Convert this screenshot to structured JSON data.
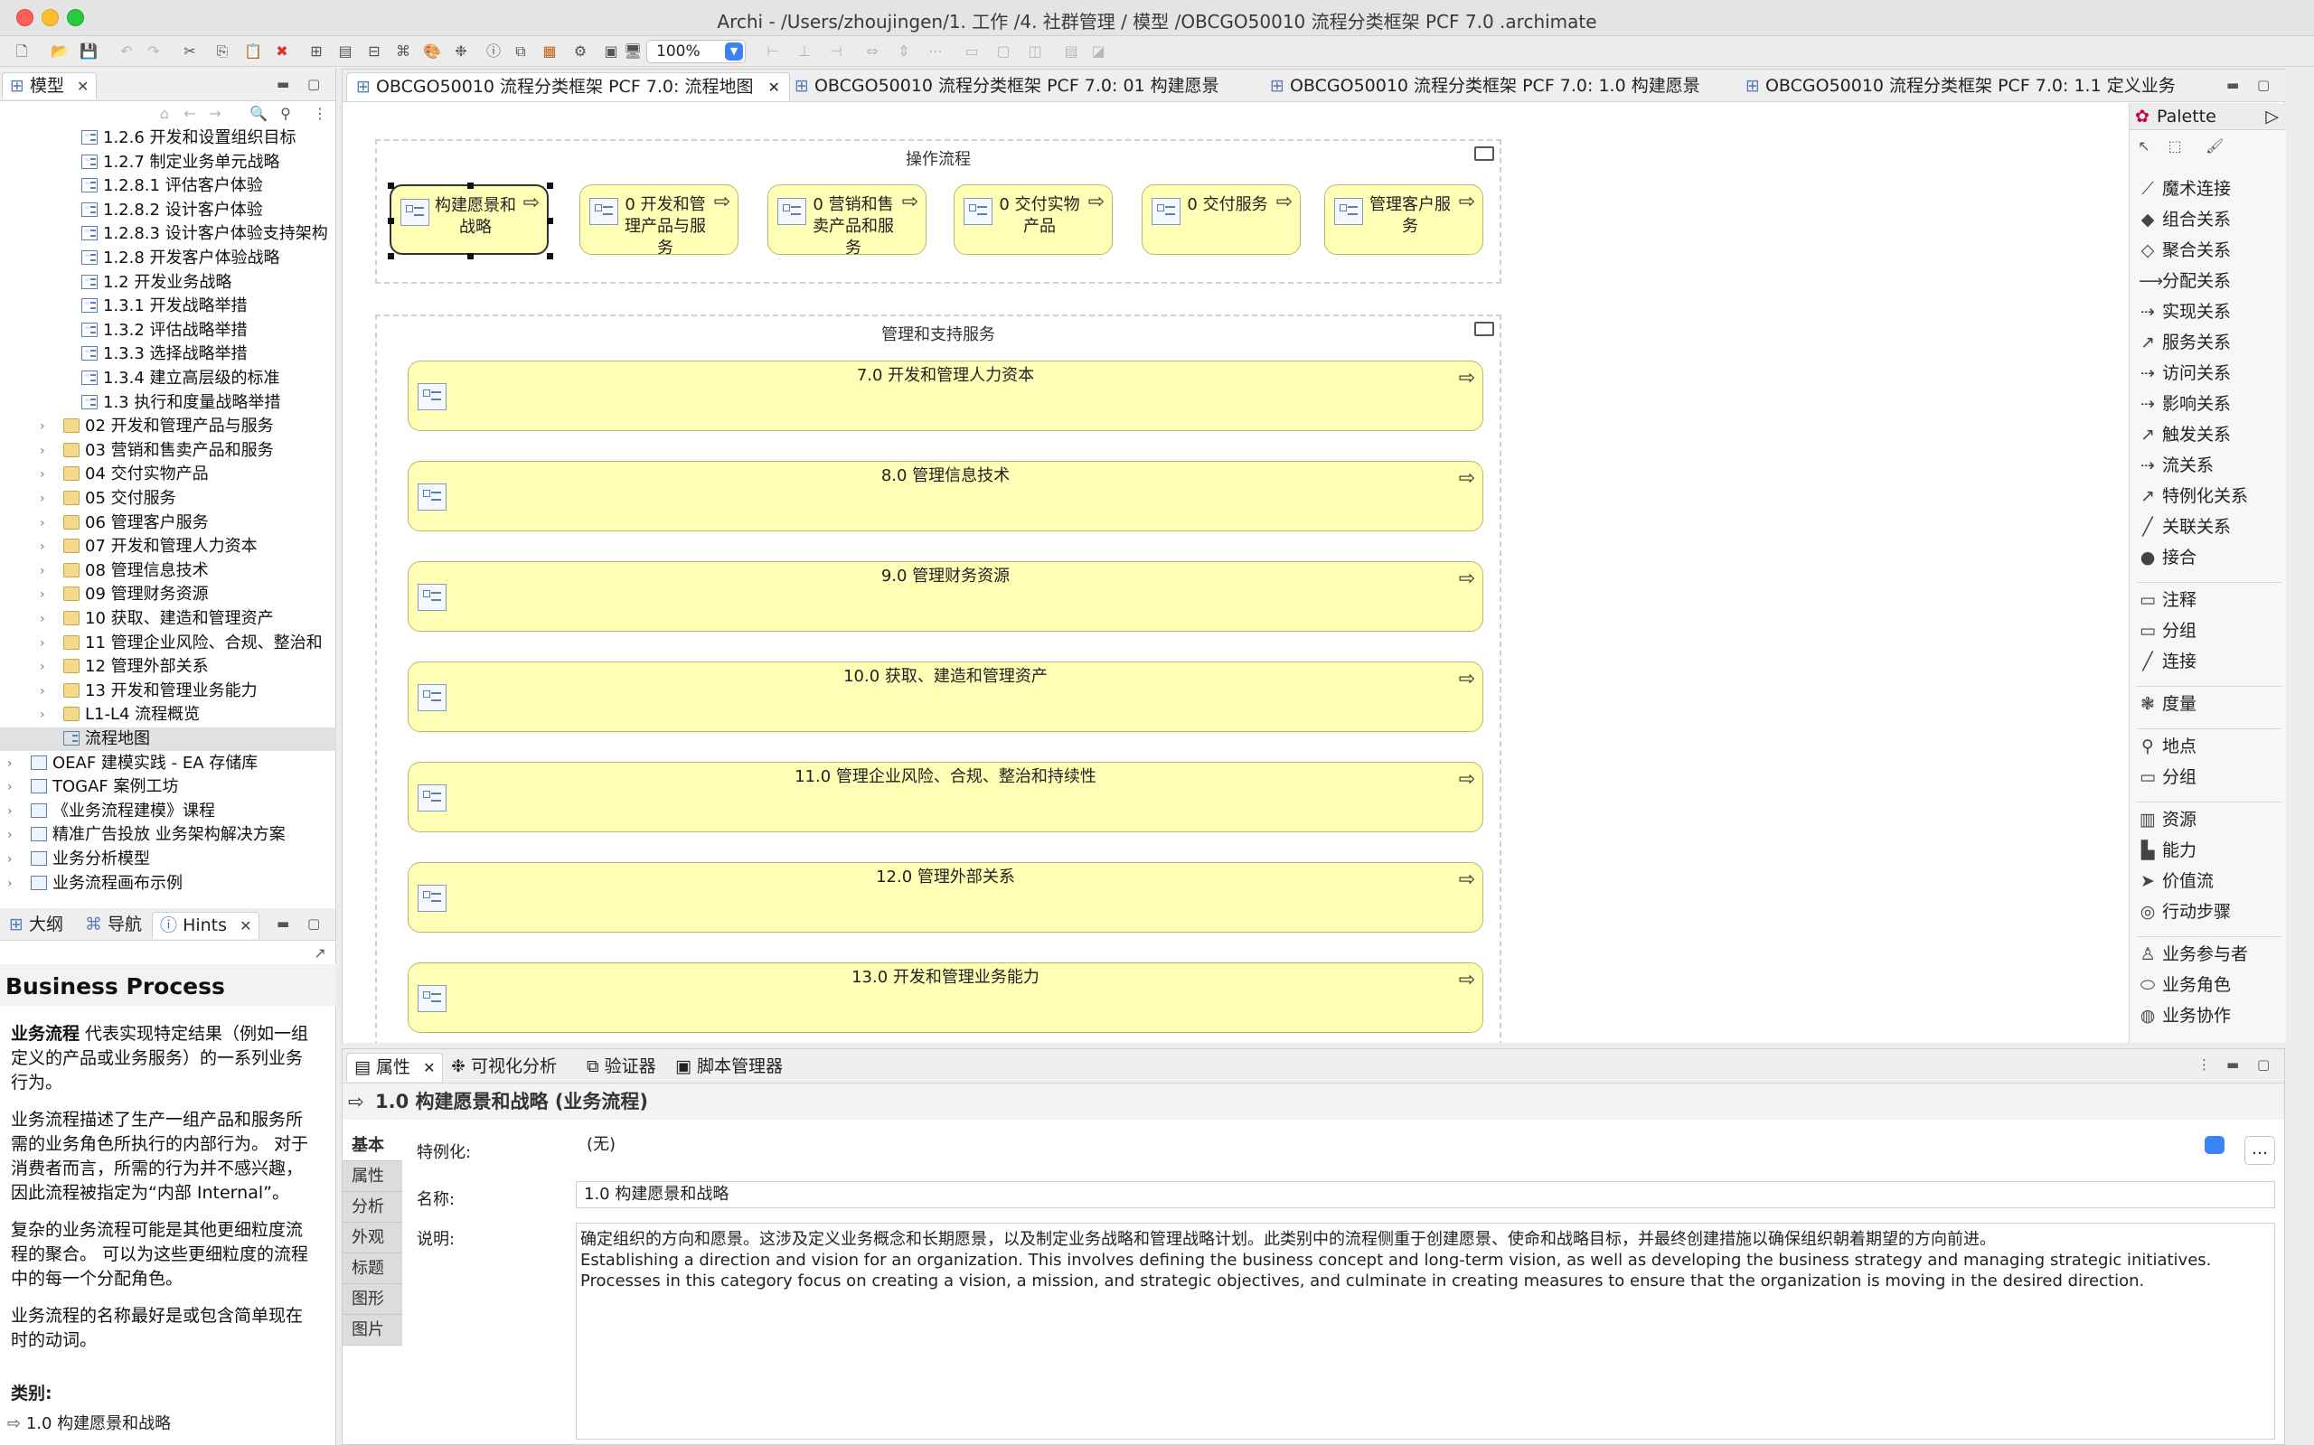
{
  "window": {
    "title": "Archi - /Users/zhoujingen/1. 工作 /4. 社群管理 / 模型 /OBCGO50010 流程分类框架 PCF 7.0 .archimate"
  },
  "toolbar": {
    "zoom": "100%"
  },
  "model_panel": {
    "tab_label": "模型",
    "tree": [
      {
        "label": "1.2.6 开发和设置组织目标",
        "icon": "diagram"
      },
      {
        "label": "1.2.7 制定业务单元战略",
        "icon": "diagram"
      },
      {
        "label": "1.2.8.1 评估客户体验",
        "icon": "diagram"
      },
      {
        "label": "1.2.8.2 设计客户体验",
        "icon": "diagram"
      },
      {
        "label": "1.2.8.3 设计客户体验支持架构",
        "icon": "diagram"
      },
      {
        "label": "1.2.8 开发客户体验战略",
        "icon": "diagram"
      },
      {
        "label": "1.2 开发业务战略",
        "icon": "diagram"
      },
      {
        "label": "1.3.1 开发战略举措",
        "icon": "diagram"
      },
      {
        "label": "1.3.2 评估战略举措",
        "icon": "diagram"
      },
      {
        "label": "1.3.3 选择战略举措",
        "icon": "diagram"
      },
      {
        "label": "1.3.4 建立高层级的标准",
        "icon": "diagram"
      },
      {
        "label": "1.3 执行和度量战略举措",
        "icon": "diagram"
      },
      {
        "label": "02 开发和管理产品与服务",
        "icon": "folder"
      },
      {
        "label": "03 营销和售卖产品和服务",
        "icon": "folder"
      },
      {
        "label": "04 交付实物产品",
        "icon": "folder"
      },
      {
        "label": "05 交付服务",
        "icon": "folder"
      },
      {
        "label": "06 管理客户服务",
        "icon": "folder"
      },
      {
        "label": "07 开发和管理人力资本",
        "icon": "folder"
      },
      {
        "label": "08 管理信息技术",
        "icon": "folder"
      },
      {
        "label": "09 管理财务资源",
        "icon": "folder"
      },
      {
        "label": "10 获取、建造和管理资产",
        "icon": "folder"
      },
      {
        "label": "11 管理企业风险、合规、整治和",
        "icon": "folder"
      },
      {
        "label": "12 管理外部关系",
        "icon": "folder"
      },
      {
        "label": "13 开发和管理业务能力",
        "icon": "folder"
      },
      {
        "label": "L1-L4 流程概览",
        "icon": "folder"
      },
      {
        "label": "流程地图",
        "icon": "diagram"
      },
      {
        "label": "OEAF 建模实践 - EA 存储库",
        "icon": "model"
      },
      {
        "label": "TOGAF 案例工坊",
        "icon": "model"
      },
      {
        "label": "《业务流程建模》课程",
        "icon": "model"
      },
      {
        "label": "精准广告投放 业务架构解决方案",
        "icon": "model"
      },
      {
        "label": "业务分析模型",
        "icon": "model"
      },
      {
        "label": "业务流程画布示例",
        "icon": "model"
      }
    ]
  },
  "hints_panel": {
    "tabs": [
      "大纲",
      "导航",
      "Hints"
    ],
    "title": "Business Process",
    "p1_bold": "业务流程",
    "p1": " 代表实现特定结果（例如一组定义的产品或业务服务）的一系列业务行为。",
    "p2": "业务流程描述了生产一组产品和服务所需的业务角色所执行的内部行为。 对于消费者而言，所需的行为并不感兴趣，因此流程被指定为“内部 Internal”。",
    "p3": "复杂的业务流程可能是其他更细粒度流程的聚合。 可以为这些更细粒度的流程中的每一个分配角色。",
    "p4": "业务流程的名称最好是或包含简单现在时的动词。",
    "category_label": "类别:",
    "category_item": "1.0 构建愿景和战略"
  },
  "editor": {
    "tabs": [
      "OBCGO50010 流程分类框架 PCF 7.0: 流程地图",
      "OBCGO50010 流程分类框架 PCF 7.0: 01 构建愿景",
      "OBCGO50010 流程分类框架 PCF 7.0: 1.0 构建愿景",
      "OBCGO50010 流程分类框架 PCF 7.0: 1.1 定义业务"
    ],
    "group1_label": "操作流程",
    "group1_items": [
      "构建愿景和战略",
      "0 开发和管理产品与服务",
      "0 营销和售卖产品和服务",
      "0 交付实物产品",
      "0 交付服务",
      "管理客户服务"
    ],
    "group2_label": "管理和支持服务",
    "group2_items": [
      "7.0 开发和管理人力资本",
      "8.0 管理信息技术",
      "9.0 管理财务资源",
      "10.0 获取、建造和管理资产",
      "11.0 管理企业风险、合规、整治和持续性",
      "12.0 管理外部关系",
      "13.0 开发和管理业务能力"
    ]
  },
  "palette": {
    "title": "Palette",
    "items": [
      {
        "label": "魔术连接",
        "icon": "magic-connector-icon"
      },
      {
        "label": "组合关系",
        "icon": "composition-icon"
      },
      {
        "label": "聚合关系",
        "icon": "aggregation-icon"
      },
      {
        "label": "分配关系",
        "icon": "assignment-icon"
      },
      {
        "label": "实现关系",
        "icon": "realization-icon"
      },
      {
        "label": "服务关系",
        "icon": "serving-icon"
      },
      {
        "label": "访问关系",
        "icon": "access-icon"
      },
      {
        "label": "影响关系",
        "icon": "influence-icon"
      },
      {
        "label": "触发关系",
        "icon": "triggering-icon"
      },
      {
        "label": "流关系",
        "icon": "flow-icon"
      },
      {
        "label": "特例化关系",
        "icon": "specialization-icon"
      },
      {
        "label": "关联关系",
        "icon": "association-icon"
      },
      {
        "label": "接合",
        "icon": "junction-icon"
      },
      {
        "label": "注释",
        "icon": "note-icon"
      },
      {
        "label": "分组",
        "icon": "group-icon"
      },
      {
        "label": "连接",
        "icon": "connection-icon"
      },
      {
        "label": "度量",
        "icon": "measure-icon"
      },
      {
        "label": "地点",
        "icon": "location-icon"
      },
      {
        "label": "分组",
        "icon": "grouping-icon"
      },
      {
        "label": "资源",
        "icon": "resource-icon"
      },
      {
        "label": "能力",
        "icon": "capability-icon"
      },
      {
        "label": "价值流",
        "icon": "value-stream-icon"
      },
      {
        "label": "行动步骤",
        "icon": "course-of-action-icon"
      },
      {
        "label": "业务参与者",
        "icon": "business-actor-icon"
      },
      {
        "label": "业务角色",
        "icon": "business-role-icon"
      },
      {
        "label": "业务协作",
        "icon": "business-collaboration-icon"
      }
    ]
  },
  "properties": {
    "tabs": [
      "属性",
      "可视化分析",
      "验证器",
      "脚本管理器"
    ],
    "header": "1.0 构建愿景和战略 (业务流程)",
    "side_tabs": [
      "基本",
      "属性",
      "分析",
      "外观",
      "标题",
      "图形",
      "图片"
    ],
    "specialization_label": "特例化:",
    "specialization_value": "(无)",
    "name_label": "名称:",
    "name_value": "1.0 构建愿景和战略",
    "desc_label": "说明:",
    "desc_line1": "确定组织的方向和愿景。这涉及定义业务概念和长期愿景，以及制定业务战略和管理战略计划。此类别中的流程侧重于创建愿景、使命和战略目标，并最终创建措施以确保组织朝着期望的方向前进。",
    "desc_line2": "Establishing a direction and vision for an organization. This involves defining the business  concept and long-term vision, as well as developing the business strategy and managing strategic initiatives.",
    "desc_line3": "Processes in this  category focus on creating a vision, a mission, and strategic objectives, and culminate in creating measures to ensure that the  organization is moving in the desired direction."
  }
}
